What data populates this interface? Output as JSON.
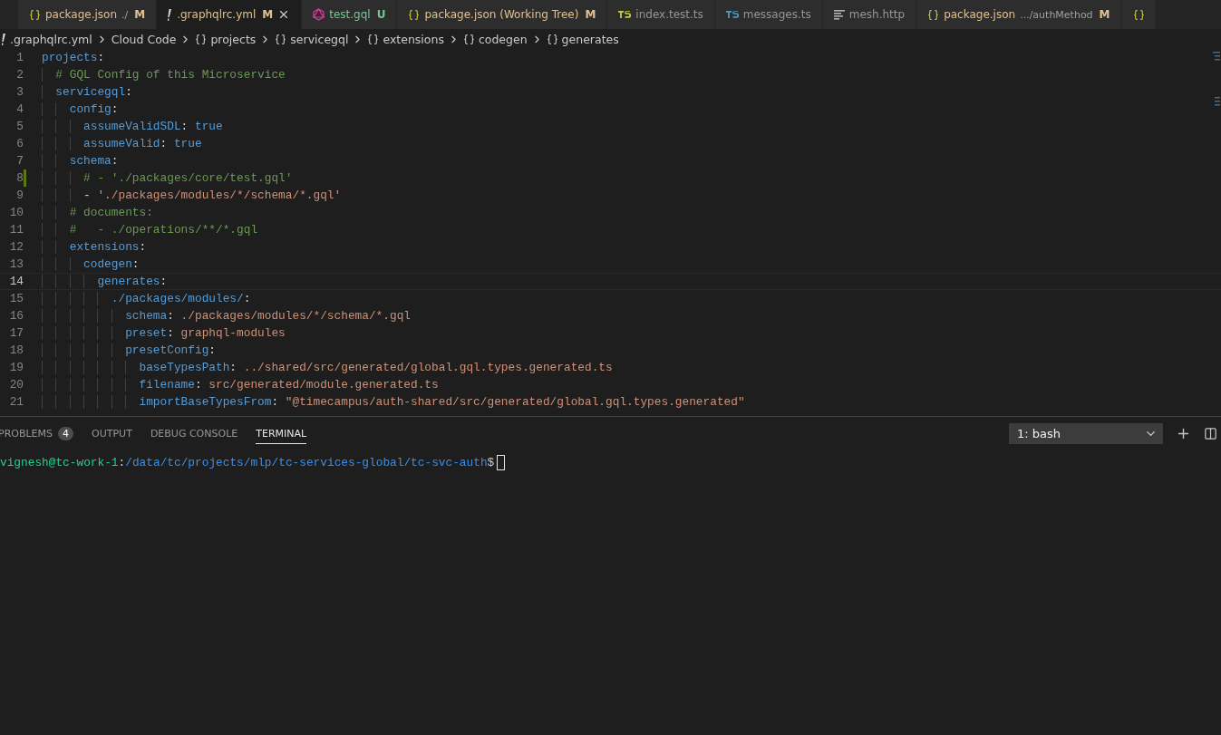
{
  "tabs": [
    {
      "kind": "json",
      "label": "package.json",
      "description": "./",
      "badge": "M",
      "color": "#e2c08d",
      "selected": false
    },
    {
      "kind": "yaml",
      "label": ".graphqlrc.yml",
      "badge": "M",
      "color": "#e2c08d",
      "selected": true
    },
    {
      "kind": "graphql",
      "label": "test.gql",
      "badge": "U",
      "color": "#73c991",
      "selected": false
    },
    {
      "kind": "json",
      "label": "package.json (Working Tree)",
      "badge": "M",
      "color": "#e2c08d",
      "selected": false
    },
    {
      "kind": "ts-yellow",
      "label": "index.test.ts",
      "color": "#969696",
      "selected": false
    },
    {
      "kind": "ts-blue",
      "label": "messages.ts",
      "color": "#969696",
      "selected": false
    },
    {
      "kind": "http",
      "label": "mesh.http",
      "color": "#969696",
      "selected": false
    },
    {
      "kind": "json",
      "label": "package.json",
      "description": ".../authMethod",
      "badge": "M",
      "color": "#e2c08d",
      "selected": false
    },
    {
      "kind": "json",
      "selected": false
    }
  ],
  "breadcrumbs": [
    {
      "kind": "yaml",
      "label": ".graphqlrc.yml"
    },
    {
      "kind": "plain",
      "label": "Cloud Code"
    },
    {
      "kind": "object",
      "label": "projects"
    },
    {
      "kind": "object",
      "label": "servicegql"
    },
    {
      "kind": "object",
      "label": "extensions"
    },
    {
      "kind": "object",
      "label": "codegen"
    },
    {
      "kind": "object",
      "label": "generates"
    }
  ],
  "code_lines": [
    {
      "number": "1",
      "active": false,
      "modified": false,
      "tokens": [
        {
          "kind": "key",
          "text": "projects"
        },
        {
          "kind": "punct",
          "text": ":"
        }
      ]
    },
    {
      "number": "2",
      "active": false,
      "modified": false,
      "tokens": [
        {
          "kind": "comment",
          "text": "  # GQL Config of this Microservice"
        }
      ]
    },
    {
      "number": "3",
      "active": false,
      "modified": false,
      "tokens": [
        {
          "kind": "key",
          "text": "  servicegql"
        },
        {
          "kind": "punct",
          "text": ":"
        }
      ]
    },
    {
      "number": "4",
      "active": false,
      "modified": false,
      "tokens": [
        {
          "kind": "key",
          "text": "    config"
        },
        {
          "kind": "punct",
          "text": ":"
        }
      ]
    },
    {
      "number": "5",
      "active": false,
      "modified": false,
      "tokens": [
        {
          "kind": "key",
          "text": "      assumeValidSDL"
        },
        {
          "kind": "punct",
          "text": ": "
        },
        {
          "kind": "bool",
          "text": "true"
        }
      ]
    },
    {
      "number": "6",
      "active": false,
      "modified": false,
      "tokens": [
        {
          "kind": "key",
          "text": "      assumeValid"
        },
        {
          "kind": "punct",
          "text": ": "
        },
        {
          "kind": "bool",
          "text": "true"
        }
      ]
    },
    {
      "number": "7",
      "active": false,
      "modified": false,
      "tokens": [
        {
          "kind": "key",
          "text": "    schema"
        },
        {
          "kind": "punct",
          "text": ":"
        }
      ]
    },
    {
      "number": "8",
      "active": false,
      "modified": true,
      "tokens": [
        {
          "kind": "comment",
          "text": "      # - './packages/core/test.gql'"
        }
      ]
    },
    {
      "number": "9",
      "active": false,
      "modified": false,
      "tokens": [
        {
          "kind": "punct",
          "text": "      - "
        },
        {
          "kind": "string",
          "text": "'./packages/modules/*/schema/*.gql'"
        }
      ]
    },
    {
      "number": "10",
      "active": false,
      "modified": false,
      "tokens": [
        {
          "kind": "comment",
          "text": "    # documents:"
        }
      ]
    },
    {
      "number": "11",
      "active": false,
      "modified": false,
      "tokens": [
        {
          "kind": "comment",
          "text": "    #   - ./operations/**/*.gql"
        }
      ]
    },
    {
      "number": "12",
      "active": false,
      "modified": false,
      "tokens": [
        {
          "kind": "key",
          "text": "    extensions"
        },
        {
          "kind": "punct",
          "text": ":"
        }
      ]
    },
    {
      "number": "13",
      "active": false,
      "modified": false,
      "tokens": [
        {
          "kind": "key",
          "text": "      codegen"
        },
        {
          "kind": "punct",
          "text": ":"
        }
      ]
    },
    {
      "number": "14",
      "active": true,
      "modified": false,
      "tokens": [
        {
          "kind": "key",
          "text": "        generates"
        },
        {
          "kind": "punct",
          "text": ":"
        }
      ]
    },
    {
      "number": "15",
      "active": false,
      "modified": false,
      "tokens": [
        {
          "kind": "key",
          "text": "          ./packages/modules/"
        },
        {
          "kind": "punct",
          "text": ":"
        }
      ]
    },
    {
      "number": "16",
      "active": false,
      "modified": false,
      "tokens": [
        {
          "kind": "key",
          "text": "            schema"
        },
        {
          "kind": "punct",
          "text": ": "
        },
        {
          "kind": "string",
          "text": "./packages/modules/*/schema/*.gql"
        }
      ]
    },
    {
      "number": "17",
      "active": false,
      "modified": false,
      "tokens": [
        {
          "kind": "key",
          "text": "            preset"
        },
        {
          "kind": "punct",
          "text": ": "
        },
        {
          "kind": "string",
          "text": "graphql-modules"
        }
      ]
    },
    {
      "number": "18",
      "active": false,
      "modified": false,
      "tokens": [
        {
          "kind": "key",
          "text": "            presetConfig"
        },
        {
          "kind": "punct",
          "text": ":"
        }
      ]
    },
    {
      "number": "19",
      "active": false,
      "modified": false,
      "tokens": [
        {
          "kind": "key",
          "text": "              baseTypesPath"
        },
        {
          "kind": "punct",
          "text": ": "
        },
        {
          "kind": "string",
          "text": "../shared/src/generated/global.gql.types.generated.ts"
        }
      ]
    },
    {
      "number": "20",
      "active": false,
      "modified": false,
      "tokens": [
        {
          "kind": "key",
          "text": "              filename"
        },
        {
          "kind": "punct",
          "text": ": "
        },
        {
          "kind": "string",
          "text": "src/generated/module.generated.ts"
        }
      ]
    },
    {
      "number": "21",
      "active": false,
      "modified": false,
      "tokens": [
        {
          "kind": "key",
          "text": "              importBaseTypesFrom"
        },
        {
          "kind": "punct",
          "text": ": "
        },
        {
          "kind": "string",
          "text": "\"@timecampus/auth-shared/src/generated/global.gql.types.generated\""
        }
      ]
    }
  ],
  "panel": {
    "tabs": [
      {
        "label": "PROBLEMS",
        "count": "4",
        "selected": false
      },
      {
        "label": "OUTPUT",
        "selected": false
      },
      {
        "label": "DEBUG CONSOLE",
        "selected": false
      },
      {
        "label": "TERMINAL",
        "selected": true
      }
    ],
    "terminal_select": {
      "value": "1: bash"
    },
    "terminal": {
      "user_host": "vignesh@tc-work-1",
      "separator": ":",
      "path": "/data/tc/projects/mlp/tc-services-global/tc-svc-auth",
      "prompt": "$"
    }
  }
}
